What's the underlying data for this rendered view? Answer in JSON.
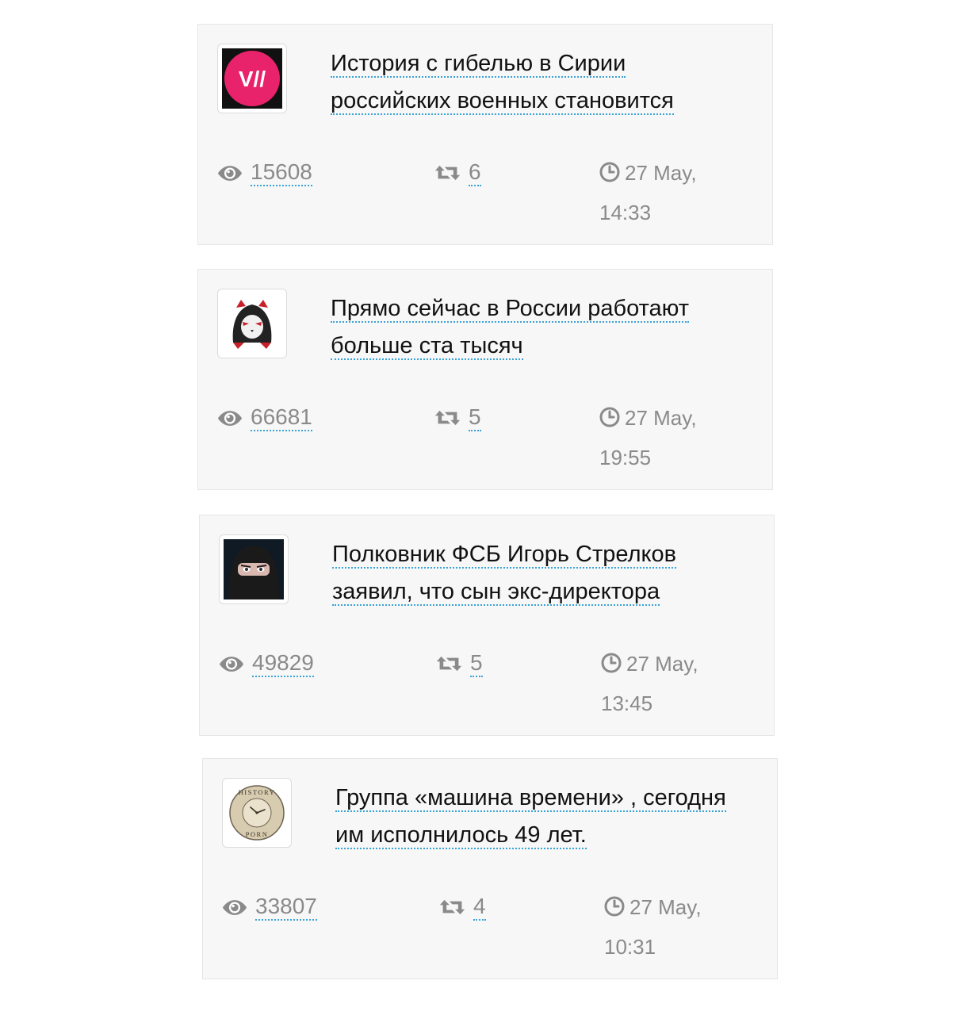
{
  "posts": [
    {
      "channel_icon": "vice-logo-icon",
      "title": "История с гибелью в Сирии российских военных становится",
      "views": "15608",
      "reposts": "6",
      "date": "27 May,",
      "time": "14:33"
    },
    {
      "channel_icon": "hooded-cat-icon",
      "title": "Прямо сейчас в России работают больше ста тысяч",
      "views": "66681",
      "reposts": "5",
      "date": "27 May,",
      "time": "19:55"
    },
    {
      "channel_icon": "balaclava-face-icon",
      "title": "Полковник ФСБ Игорь Стрелков заявил, что сын экс-директора",
      "views": "49829",
      "reposts": "5",
      "date": "27 May,",
      "time": "13:45"
    },
    {
      "channel_icon": "history-clock-icon",
      "title": "Группа «машина времени» , сегодня им исполнилось 49 лет.",
      "views": "33807",
      "reposts": "4",
      "date": "27 May,",
      "time": "10:31"
    }
  ],
  "logo_text": {
    "vice": "V//",
    "history_top": "HISTORY",
    "history_bottom": "PORN"
  },
  "colors": {
    "card_bg": "#f7f7f7",
    "meta_text": "#8a8a8a",
    "link_underline": "#3aa3d6",
    "vice_pink": "#e8226b"
  }
}
